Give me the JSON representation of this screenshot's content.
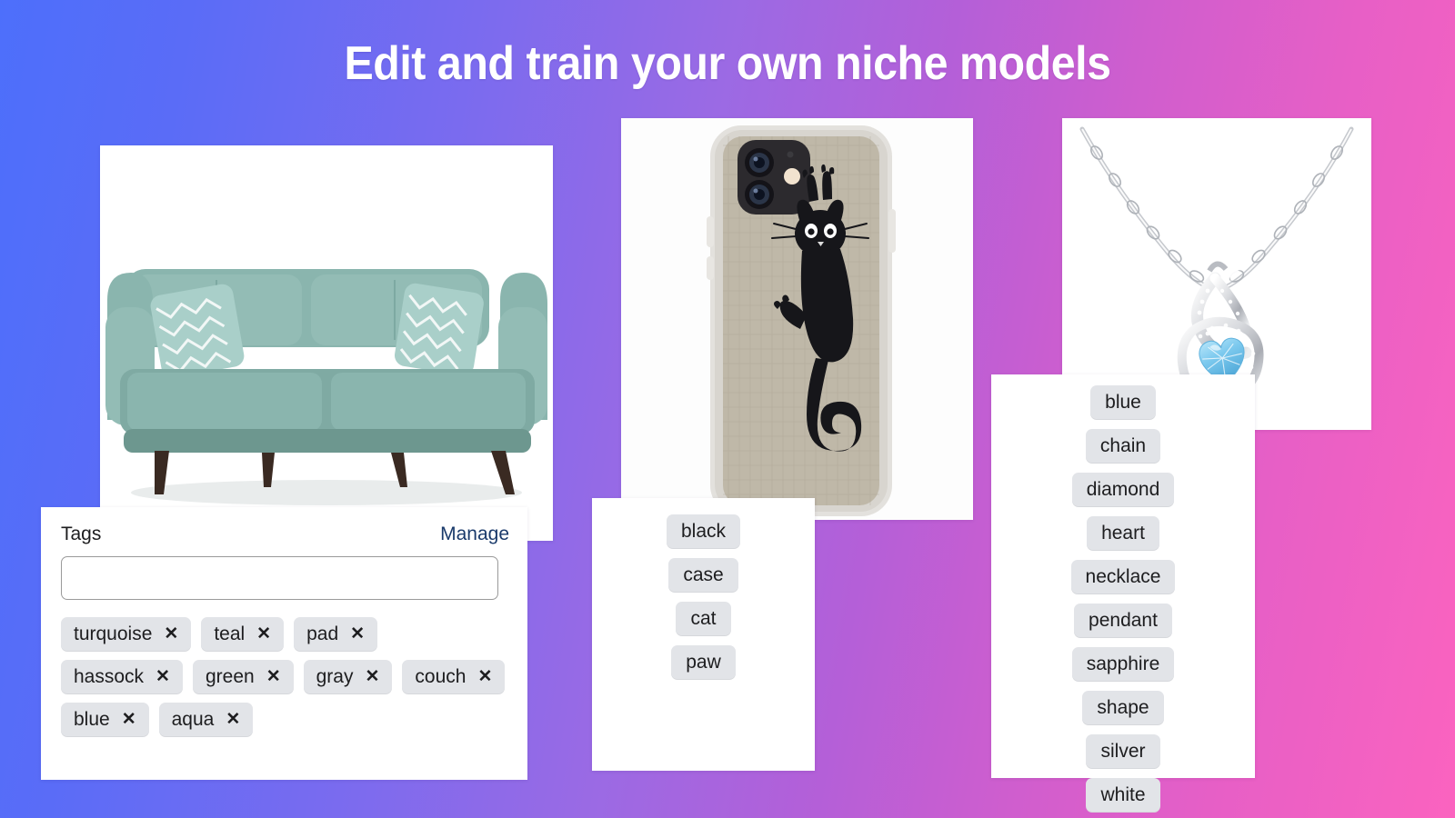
{
  "page": {
    "title": "Edit and train your own niche models",
    "background_gradient_start": "#4d6ffb",
    "background_gradient_mid": "#9b6ae4",
    "background_gradient_end": "#fb63bf"
  },
  "panels": [
    {
      "id": "sofa",
      "product": "teal tufted sofa with patterned throw pillows",
      "tags_label": "Tags",
      "manage_label": "Manage",
      "input_value": "",
      "input_placeholder": "",
      "tag_chip_bg": "#e2e4e8",
      "manage_link_color": "#1a3a6b",
      "tags": [
        {
          "label": "turquoise",
          "remove": "✕"
        },
        {
          "label": "teal",
          "remove": "✕"
        },
        {
          "label": "pad",
          "remove": "✕"
        },
        {
          "label": "hassock",
          "remove": "✕"
        },
        {
          "label": "green",
          "remove": "✕"
        },
        {
          "label": "gray",
          "remove": "✕"
        },
        {
          "label": "couch",
          "remove": "✕"
        },
        {
          "label": "blue",
          "remove": "✕"
        },
        {
          "label": "aqua",
          "remove": "✕"
        }
      ]
    },
    {
      "id": "phone",
      "product": "iPhone case with black cat climbing graphic on linen texture",
      "tags": [
        {
          "label": "black"
        },
        {
          "label": "case"
        },
        {
          "label": "cat"
        },
        {
          "label": "paw"
        }
      ]
    },
    {
      "id": "necklace",
      "product": "silver infinity pendant necklace with blue heart gemstone",
      "tags": [
        {
          "label": "blue"
        },
        {
          "label": "chain"
        },
        {
          "label": "diamond"
        },
        {
          "label": "heart"
        },
        {
          "label": "necklace"
        },
        {
          "label": "pendant"
        },
        {
          "label": "sapphire"
        },
        {
          "label": "shape"
        },
        {
          "label": "silver"
        },
        {
          "label": "white"
        }
      ]
    }
  ]
}
